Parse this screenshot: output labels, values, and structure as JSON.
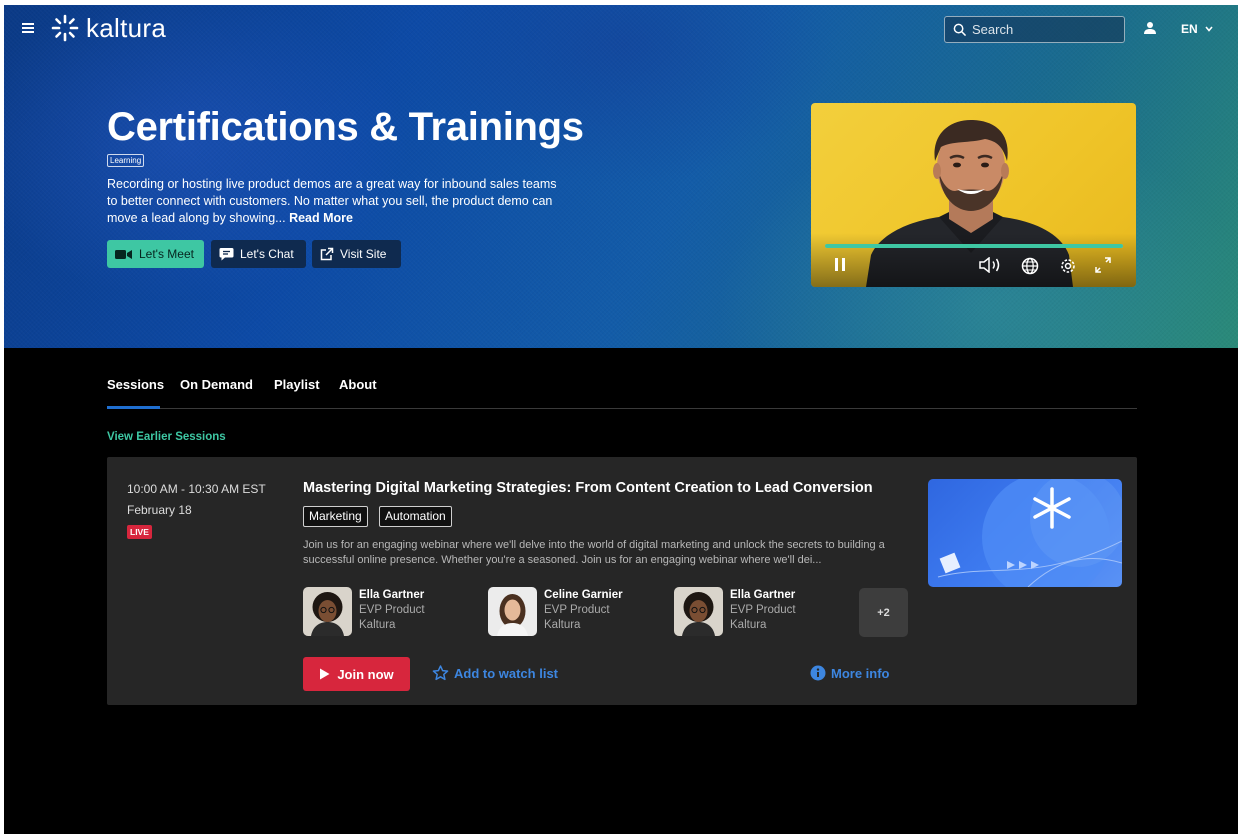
{
  "header": {
    "logo_text": "kaltura",
    "search_placeholder": "Search",
    "language": "EN"
  },
  "hero": {
    "title": "Certifications & Trainings",
    "tag": "Learning",
    "description": "Recording or hosting live product demos are a great way for inbound sales teams to better connect with customers. No matter what you sell, the product demo can move a lead along by showing...",
    "read_more": "Read More",
    "buttons": {
      "meet": "Let's Meet",
      "chat": "Let's Chat",
      "visit": "Visit Site"
    },
    "player": {
      "progress": 1.0
    }
  },
  "tabs": [
    "Sessions",
    "On Demand",
    "Playlist",
    "About"
  ],
  "view_earlier": "View Earlier Sessions",
  "session": {
    "time": "10:00 AM - 10:30 AM EST",
    "date": "February 18",
    "live_badge": "LIVE",
    "title": "Mastering Digital Marketing Strategies: From Content Creation to Lead Conversion",
    "tags": [
      "Marketing",
      "Automation"
    ],
    "description": "Join us for an engaging webinar where we'll delve into the world of digital marketing and unlock the secrets to building a successful online presence. Whether you're a seasoned. Join us for an engaging webinar where we'll dei...",
    "speakers": [
      {
        "name": "Ella Gartner",
        "role": "EVP Product",
        "org": "Kaltura"
      },
      {
        "name": "Celine Garnier",
        "role": "EVP Product",
        "org": "Kaltura"
      },
      {
        "name": "Ella Gartner",
        "role": "EVP Product",
        "org": "Kaltura"
      }
    ],
    "more_speakers": "+2",
    "join_label": "Join now",
    "watchlist_label": "Add to watch list",
    "more_info_label": "More info"
  },
  "colors": {
    "accent_green": "#3ec7a3",
    "live_red": "#d7263d",
    "link_blue": "#3d86e0",
    "tab_underline": "#1f6fd1"
  }
}
